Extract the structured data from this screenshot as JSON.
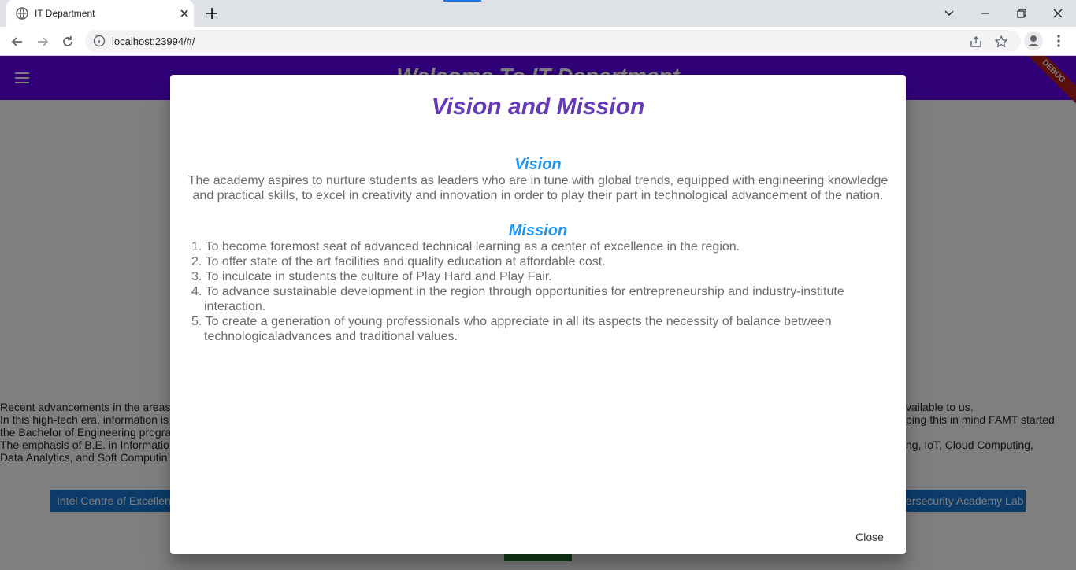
{
  "browser": {
    "tab_title": "IT Department",
    "url": "localhost:23994/#/"
  },
  "app": {
    "title": "Welcome To IT Department",
    "debug_label": "DEBUG",
    "bg_lines_left": [
      "Recent advancements in the areas",
      " In this high-tech era, information is",
      " the Bachelor of Engineering progra",
      " The emphasis of B.E. in Informatio",
      " Data Analytics, and Soft Computin"
    ],
    "bg_lines_right": [
      "vailable to us.",
      "ping this in mind FAMT started",
      "ng, IoT, Cloud Computing,"
    ],
    "lab_left": "Intel Centre of Excellenc",
    "lab_right": "ersecurity Academy Lab"
  },
  "dialog": {
    "title": "Vision and Mission",
    "vision_heading": "Vision",
    "vision_text": "The academy aspires to nurture students as leaders who are in tune with global trends, equipped with engineering knowledge and practical skills, to excel in creativity and innovation in order to play their part in technological advancement of the nation.",
    "mission_heading": "Mission",
    "mission_items": [
      "1. To become foremost seat of advanced technical learning as a center of excellence in the region.",
      "2. To offer state of the art facilities and quality education at affordable cost.",
      "3. To inculcate in students the culture of Play Hard and Play Fair.",
      "4. To advance sustainable development in the region through opportunities for entrepreneurship and industry-institute interaction.",
      "5. To create a generation of young professionals who appreciate in all its aspects the necessity of balance between technologicaladvances and traditional values."
    ],
    "close_label": "Close"
  },
  "colors": {
    "appbar": "#6200ee",
    "dialog_title": "#673ab7",
    "section_heading": "#2196f3",
    "body_text": "#6b6b6b"
  }
}
